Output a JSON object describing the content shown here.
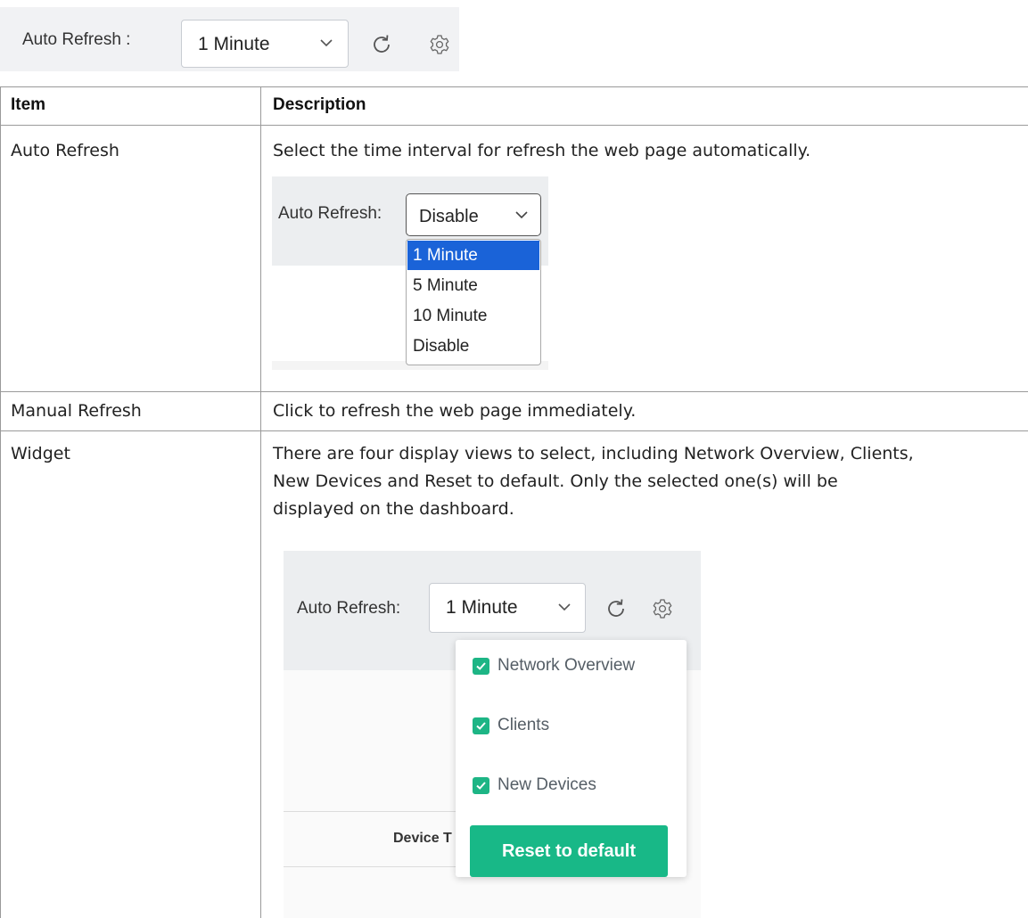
{
  "toolbar": {
    "label": "Auto Refresh :",
    "selected": "1 Minute",
    "icons": [
      "chevron-down-icon",
      "refresh-icon",
      "gear-icon"
    ]
  },
  "table": {
    "headers": {
      "item": "Item",
      "description": "Description"
    },
    "rows": [
      {
        "item": "Auto Refresh",
        "description": "Select the time interval for refresh the web page automatically."
      },
      {
        "item": "Manual Refresh",
        "description": "Click to refresh the web page immediately."
      },
      {
        "item": "Widget",
        "description_lines": [
          "There are four display views to select, including Network Overview, Clients,",
          "New Devices and Reset to default. Only the selected one(s) will be",
          "displayed on the dashboard."
        ]
      }
    ]
  },
  "auto_refresh_figure": {
    "label": "Auto Refresh:",
    "selected": "Disable",
    "options": [
      "1 Minute",
      "5 Minute",
      "10 Minute",
      "Disable"
    ],
    "highlighted": "1 Minute"
  },
  "widget_figure": {
    "label": "Auto Refresh:",
    "selected": "1 Minute",
    "menu_items": [
      "Network Overview",
      "Clients",
      "New Devices"
    ],
    "reset_label": "Reset to default",
    "partial_column_text": "Device T",
    "accent_color": "#18b887"
  },
  "colors": {
    "selection": "#1a63d8",
    "checkbox": "#1db585"
  }
}
